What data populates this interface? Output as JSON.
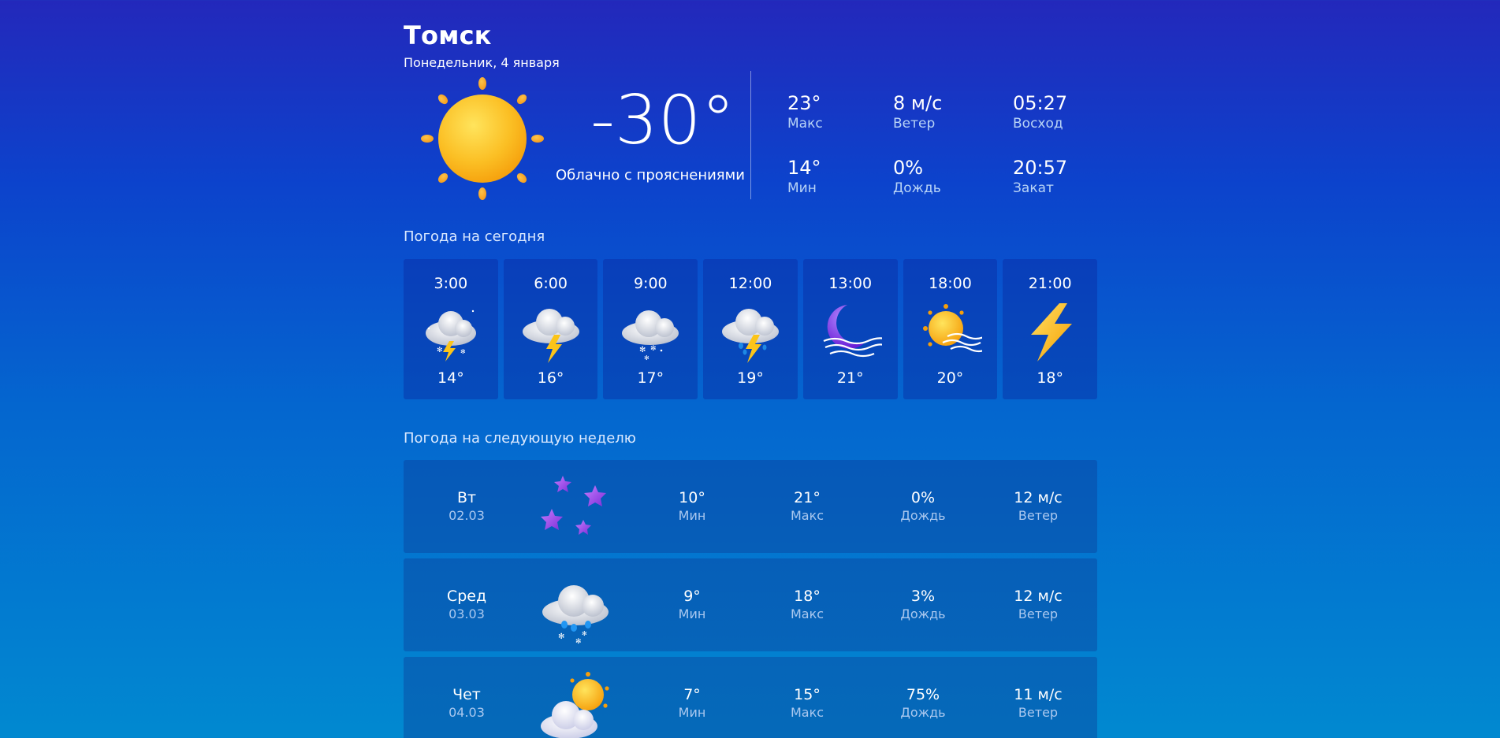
{
  "current": {
    "city": "Томск",
    "date": "Понедельник, 4 января",
    "temperature": "-30°",
    "condition": "Облачно с прояснениями",
    "icon": "sun-icon",
    "stats": [
      {
        "value": "23°",
        "label": "Макс"
      },
      {
        "value": "8 м/с",
        "label": "Ветер"
      },
      {
        "value": "05:27",
        "label": "Восход"
      },
      {
        "value": "14°",
        "label": "Мин"
      },
      {
        "value": "0%",
        "label": "Дождь"
      },
      {
        "value": "20:57",
        "label": "Закат"
      }
    ]
  },
  "today": {
    "title": "Погода на сегодня",
    "hours": [
      {
        "time": "3:00",
        "temp": "14°",
        "icon": "thunder-snow-cloud-icon"
      },
      {
        "time": "6:00",
        "temp": "16°",
        "icon": "thunder-cloud-icon"
      },
      {
        "time": "9:00",
        "temp": "17°",
        "icon": "snow-cloud-icon"
      },
      {
        "time": "12:00",
        "temp": "19°",
        "icon": "thunder-rain-cloud-icon"
      },
      {
        "time": "13:00",
        "temp": "21°",
        "icon": "moon-wind-icon"
      },
      {
        "time": "18:00",
        "temp": "20°",
        "icon": "sun-wind-icon"
      },
      {
        "time": "21:00",
        "temp": "18°",
        "icon": "lightning-icon"
      }
    ]
  },
  "week": {
    "title": "Погода на следующую неделю",
    "days": [
      {
        "day": "Вт",
        "date": "02.03",
        "icon": "stars-icon",
        "min": "10°",
        "min_label": "Мин",
        "max": "21°",
        "max_label": "Макс",
        "rain": "0%",
        "rain_label": "Дождь",
        "wind": "12 м/с",
        "wind_label": "Ветер"
      },
      {
        "day": "Сред",
        "date": "03.03",
        "icon": "sleet-cloud-icon",
        "min": "9°",
        "min_label": "Мин",
        "max": "18°",
        "max_label": "Макс",
        "rain": "3%",
        "rain_label": "Дождь",
        "wind": "12 м/с",
        "wind_label": "Ветер"
      },
      {
        "day": "Чет",
        "date": "04.03",
        "icon": "sun-behind-cloud-icon",
        "min": "7°",
        "min_label": "Мин",
        "max": "15°",
        "max_label": "Макс",
        "rain": "75%",
        "rain_label": "Дождь",
        "wind": "11 м/с",
        "wind_label": "Ветер"
      }
    ]
  },
  "colors": {
    "bg_top": "#2328bb",
    "bg_bottom": "#0189d0",
    "sun": "#fbbf24",
    "accent_purple": "#8b3cf0",
    "lightning": "#fcc419"
  }
}
